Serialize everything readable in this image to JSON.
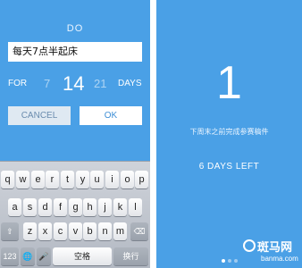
{
  "left_screen": {
    "title": "DO",
    "task_input_value": "每天7点半起床",
    "for_label": "FOR",
    "day_options": [
      "7",
      "14",
      "21"
    ],
    "selected_days": "14",
    "days_label": "DAYS",
    "cancel_label": "CANCEL",
    "ok_label": "OK",
    "keyboard": {
      "row1": [
        "q",
        "w",
        "e",
        "r",
        "t",
        "y",
        "u",
        "i",
        "o",
        "p"
      ],
      "row2": [
        "a",
        "s",
        "d",
        "f",
        "g",
        "h",
        "j",
        "k",
        "l"
      ],
      "row3_shift": "⇧",
      "row3": [
        "z",
        "x",
        "c",
        "v",
        "b",
        "n",
        "m"
      ],
      "row3_delete": "⌫",
      "numbers_key": "123",
      "globe_key": "🌐",
      "mic_key": "🎤",
      "space_label": "空格",
      "return_label": "换行"
    }
  },
  "right_screen": {
    "big_number": "1",
    "goal_text": "下周末之前完成参赛稿件",
    "days_left": "6 DAYS LEFT",
    "page_dots": 3,
    "active_dot": 1
  },
  "watermark": {
    "text": "斑马网",
    "url": "banma.com"
  },
  "colors": {
    "accent": "#4aa0e6",
    "keyboard_bg": "#c4c9d1",
    "key_bg": "#ffffff"
  }
}
